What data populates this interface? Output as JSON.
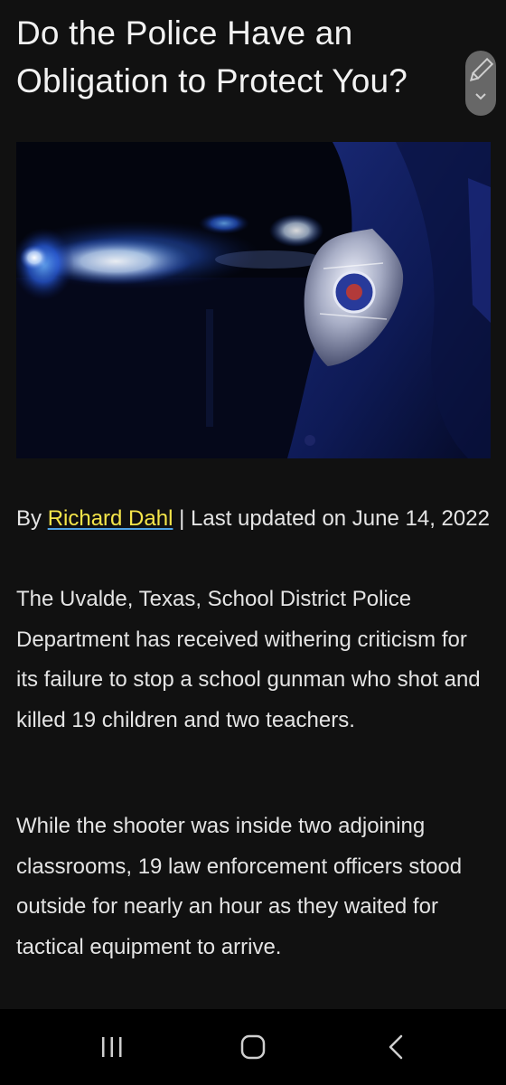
{
  "article": {
    "title": "Do the Police Have an Obligation to Protect You?",
    "hero_image": {
      "description_icon": "police-badge-photo"
    },
    "byline": {
      "prefix": "By ",
      "author": "Richard Dahl",
      "separator_updated": " | Last updated on June 14, 2022"
    },
    "paragraphs": [
      "The Uvalde, Texas, School District Police Department has received withering criticism for its failure to stop a school gunman who shot and killed 19 children and two teachers.",
      "While the shooter was inside two adjoining classrooms, 19 law enforcement officers stood outside for nearly an hour as they waited for tactical equipment to arrive."
    ]
  },
  "overlay": {
    "edit_button_icon": "pencil-icon",
    "expand_icon": "chevron-down-icon"
  },
  "navbar": {
    "recents_icon": "recent-apps-icon",
    "home_icon": "home-icon",
    "back_icon": "back-icon"
  },
  "colors": {
    "background": "#111111",
    "text": "#e4e4e4",
    "link": "#f5e64a",
    "link_underline": "#4fa4e6",
    "navbar": "#000000"
  }
}
